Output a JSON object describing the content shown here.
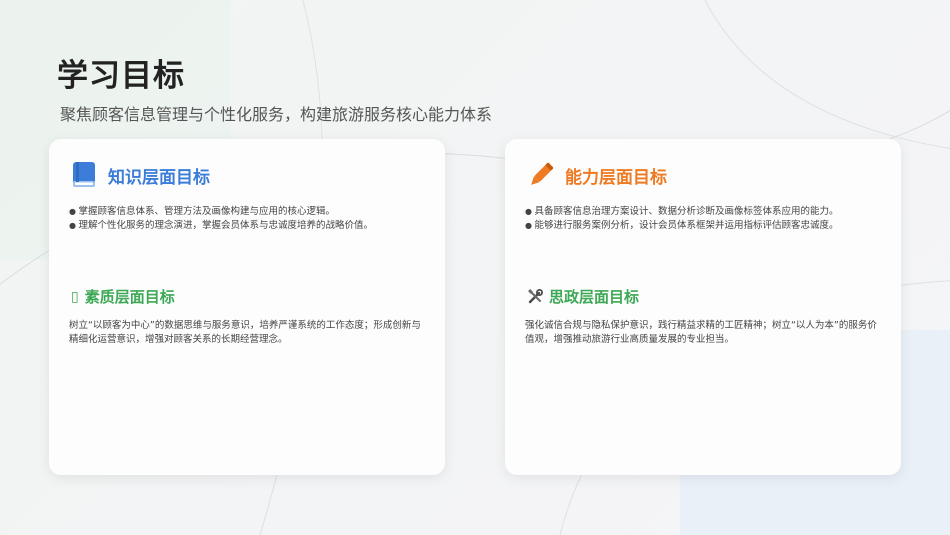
{
  "page": {
    "title": "学习目标",
    "subtitle": "聚焦顾客信息管理与个性化服务，构建旅游服务核心能力体系"
  },
  "cards": [
    {
      "knowledge": {
        "icon": "book-icon",
        "title": "知识层面目标",
        "color": "#3b7dd8",
        "bullets": [
          "掌握顾客信息体系、管理方法及画像构建与应用的核心逻辑。",
          "理解个性化服务的理念演进，掌握会员体系与忠诚度培养的战略价值。"
        ]
      },
      "quality": {
        "icon": "missing-glyph-icon",
        "icon_glyph": "▯",
        "title": "素质层面目标",
        "color": "#3da855",
        "text": "树立“以顾客为中心”的数据思维与服务意识，培养严谨系统的工作态度；形成创新与精细化运营意识，增强对顾客关系的长期经营理念。"
      }
    },
    {
      "ability": {
        "icon": "pencil-icon",
        "title": "能力层面目标",
        "color": "#ee7a22",
        "bullets": [
          "具备顾客信息治理方案设计、数据分析诊断及画像标签体系应用的能力。",
          "能够进行服务案例分析，设计会员体系框架并运用指标评估顾客忠诚度。"
        ]
      },
      "ideology": {
        "icon": "tools-icon",
        "title": "思政层面目标",
        "color": "#3da855",
        "text": "强化诚信合规与隐私保护意识，践行精益求精的工匠精神；树立“以人为本”的服务价值观，增强推动旅游行业高质量发展的专业担当。"
      }
    }
  ]
}
